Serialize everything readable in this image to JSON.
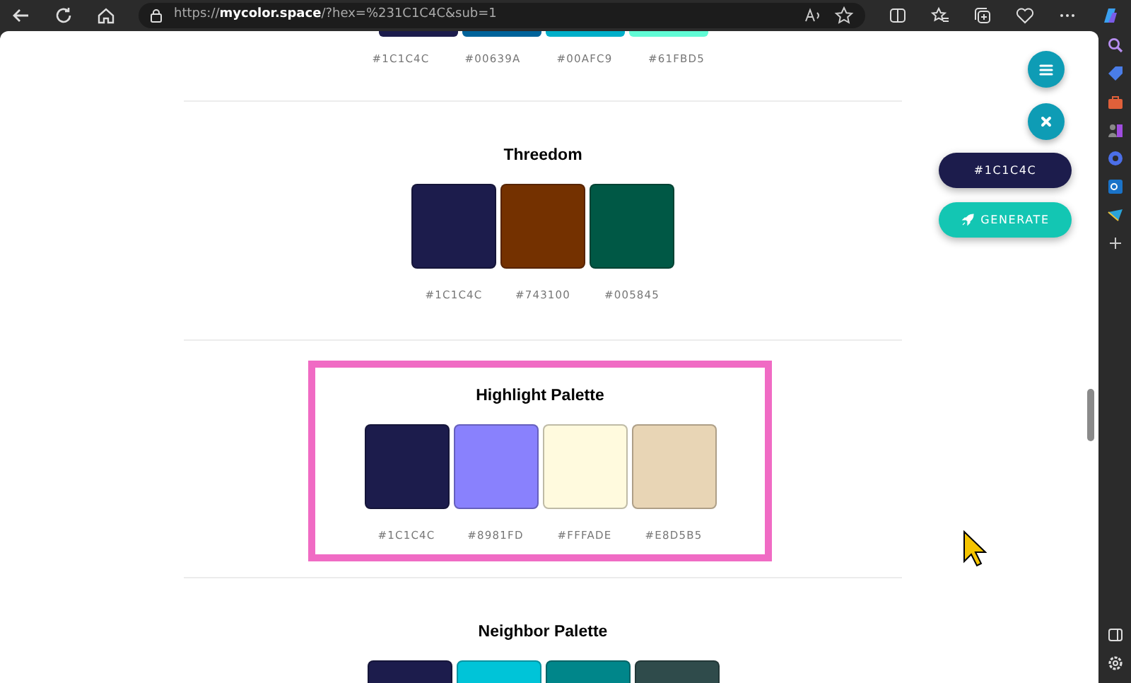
{
  "browser": {
    "url": "https://**mycolor.space**/?hex=%231C1C4C&sub=1"
  },
  "palettes": [
    {
      "swatches": [
        {
          "color": "#1c1c4c",
          "hex": "#1C1C4C"
        },
        {
          "color": "#00639a",
          "hex": "#00639A"
        },
        {
          "color": "#00afc9",
          "hex": "#00AFC9"
        },
        {
          "color": "#61fbd5",
          "hex": "#61FBD5"
        }
      ],
      "kind": "partial-top",
      "highlighted": false
    },
    {
      "name": "Threedom",
      "swatches": [
        {
          "color": "#1c1c4c",
          "hex": "#1C1C4C"
        },
        {
          "color": "#743100",
          "hex": "#743100"
        },
        {
          "color": "#005845",
          "hex": "#005845"
        }
      ],
      "kind": "full",
      "highlighted": false
    },
    {
      "name": "Highlight Palette",
      "swatches": [
        {
          "color": "#1c1c4c",
          "hex": "#1C1C4C"
        },
        {
          "color": "#8981fd",
          "hex": "#8981FD"
        },
        {
          "color": "#fffade",
          "hex": "#FFFADE"
        },
        {
          "color": "#e8d5b5",
          "hex": "#E8D5B5"
        }
      ],
      "kind": "full",
      "highlighted": true
    },
    {
      "name": "Neighbor Palette",
      "swatches": [
        {
          "color": "#1c1c4c"
        },
        {
          "color": "#00c4d8"
        },
        {
          "color": "#00868a"
        },
        {
          "color": "#2f4b4b"
        }
      ],
      "kind": "partial-bottom",
      "highlighted": false
    }
  ],
  "floating": {
    "color_code": "#1C1C4C",
    "generate_label": "GENERATE"
  }
}
